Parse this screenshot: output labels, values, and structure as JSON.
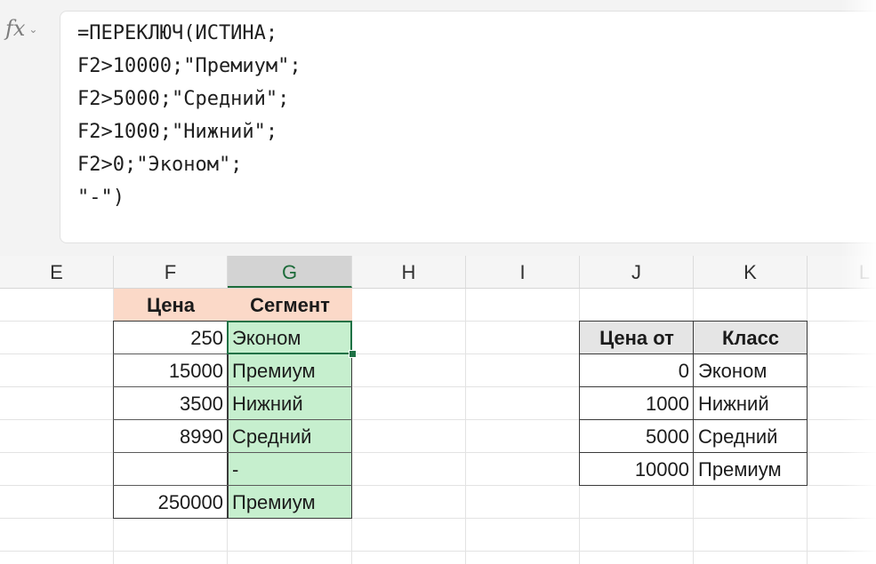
{
  "formula_bar": {
    "fx_label": "fx",
    "formula": "=ПЕРЕКЛЮЧ(ИСТИНА;\nF2>10000;\"Премиум\";\nF2>5000;\"Средний\";\nF2>1000;\"Нижний\";\nF2>0;\"Эконом\";\n\"-\")"
  },
  "columns": [
    "E",
    "F",
    "G",
    "H",
    "I",
    "J",
    "K",
    "L"
  ],
  "selected_column": "G",
  "left_table": {
    "headers": [
      "Цена",
      "Сегмент"
    ],
    "rows": [
      {
        "price": "250",
        "segment": "Эконом"
      },
      {
        "price": "15000",
        "segment": "Премиум"
      },
      {
        "price": "3500",
        "segment": "Нижний"
      },
      {
        "price": "8990",
        "segment": "Средний"
      },
      {
        "price": "",
        "segment": "-"
      },
      {
        "price": "250000",
        "segment": "Премиум"
      }
    ]
  },
  "right_table": {
    "headers": [
      "Цена от",
      "Класс"
    ],
    "rows": [
      {
        "from": "0",
        "class": "Эконом"
      },
      {
        "from": "1000",
        "class": "Нижний"
      },
      {
        "from": "5000",
        "class": "Средний"
      },
      {
        "from": "10000",
        "class": "Премиум"
      }
    ]
  },
  "colors": {
    "header_fill_left": "#fbd9c8",
    "header_fill_right": "#e5e5e5",
    "result_fill": "#c6efce",
    "selection": "#1e7145"
  }
}
